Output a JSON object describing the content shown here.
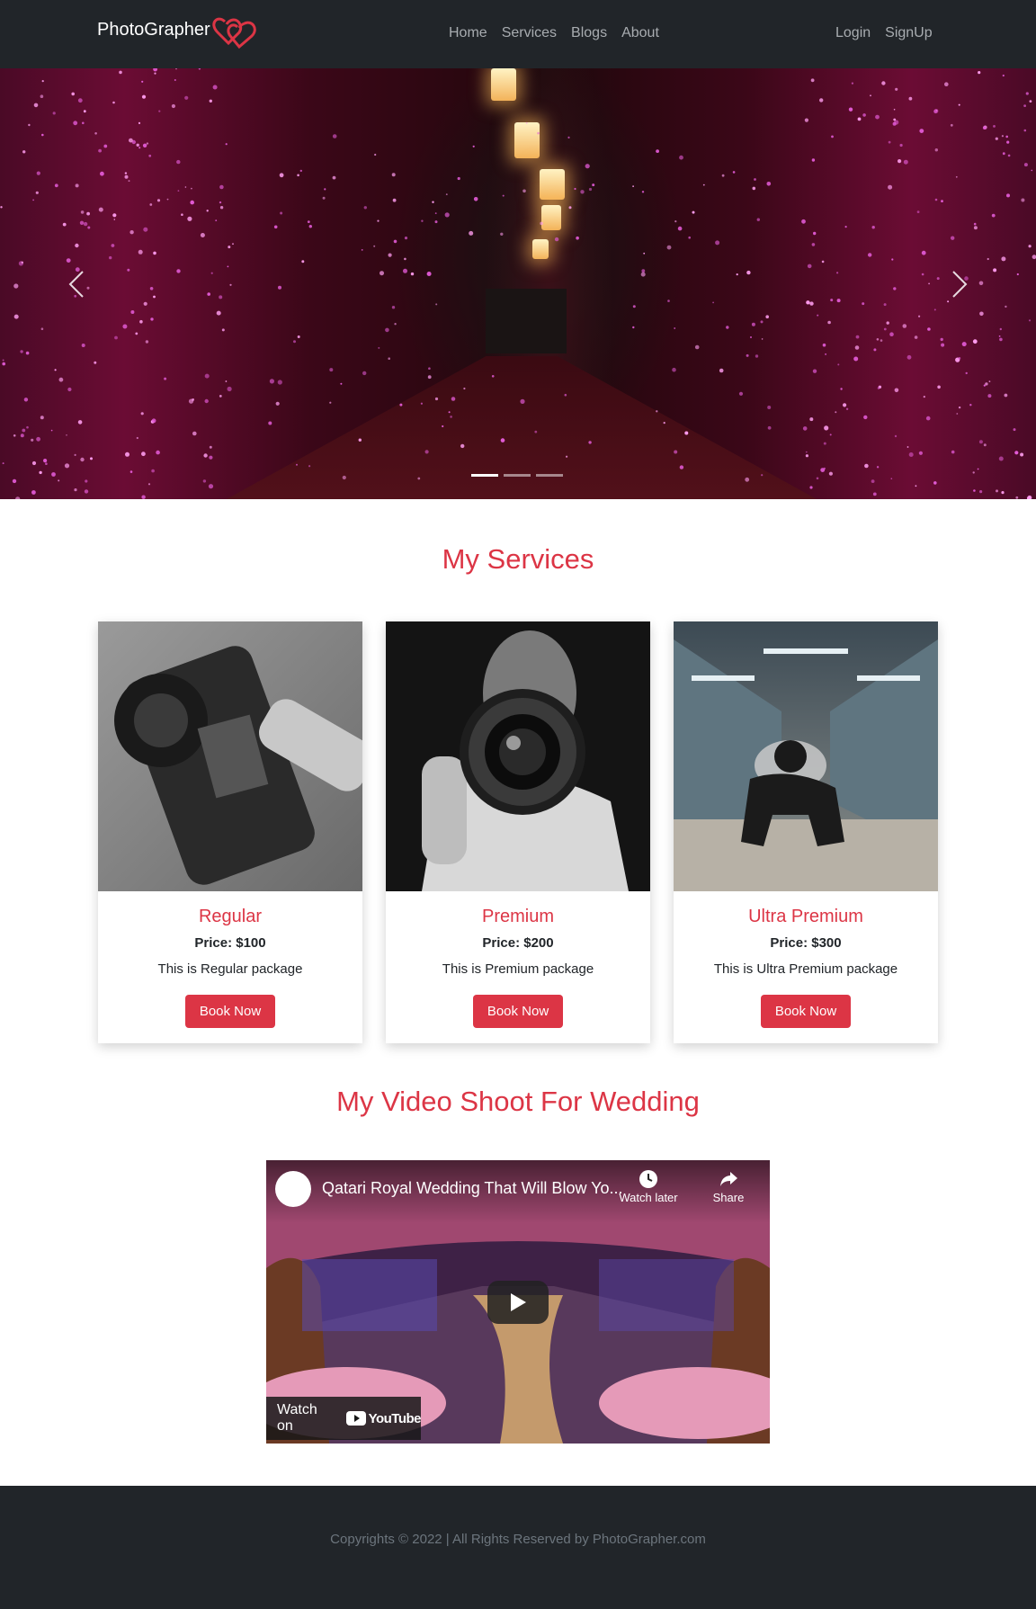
{
  "navbar": {
    "brand": "PhotoGrapher",
    "links": [
      "Home",
      "Services",
      "Blogs",
      "About"
    ],
    "auth": [
      "Login",
      "SignUp"
    ]
  },
  "carousel": {
    "slide_count": 3,
    "active_slide": 1
  },
  "services": {
    "title": "My Services",
    "cards": [
      {
        "title": "Regular",
        "price": "Price: $100",
        "description": "This is Regular package",
        "button": "Book Now"
      },
      {
        "title": "Premium",
        "price": "Price: $200",
        "description": "This is Premium package",
        "button": "Book Now"
      },
      {
        "title": "Ultra Premium",
        "price": "Price: $300",
        "description": "This is Ultra Premium package",
        "button": "Book Now"
      }
    ]
  },
  "video_section": {
    "title": "My Video Shoot For Wedding",
    "video_title": "Qatari Royal Wedding That Will Blow Yo...",
    "watch_later": "Watch later",
    "share": "Share",
    "watch_on": "Watch on",
    "youtube": "YouTube"
  },
  "footer": {
    "text": "Copyrights © 2022 | All Rights Reserved by PhotoGrapher.com"
  },
  "colors": {
    "accent": "#dc3545",
    "navbar_bg": "#212529",
    "nav_link": "#a8acb0"
  },
  "icons": {
    "brand_logo": "double-heart-icon",
    "prev": "chevron-left-icon",
    "next": "chevron-right-icon",
    "play": "play-icon",
    "watch_later": "clock-icon",
    "share": "share-arrow-icon"
  }
}
